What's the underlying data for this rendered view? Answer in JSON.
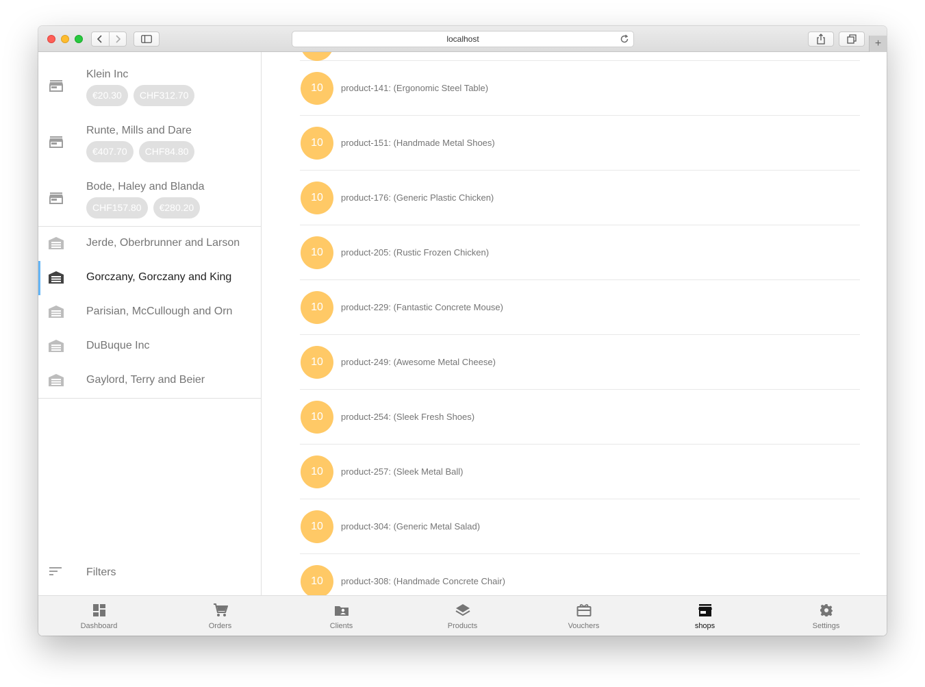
{
  "browser": {
    "url": "localhost"
  },
  "sidebar": {
    "shops": [
      {
        "name": "Klein Inc",
        "chips": [
          "€20.30",
          "CHF312.70"
        ]
      },
      {
        "name": "Runte, Mills and Dare",
        "chips": [
          "€407.70",
          "CHF84.80"
        ]
      },
      {
        "name": "Bode, Haley and Blanda",
        "chips": [
          "CHF157.80",
          "€280.20"
        ]
      }
    ],
    "warehouses": [
      {
        "name": "Jerde, Oberbrunner and Larson",
        "active": false
      },
      {
        "name": "Gorczany, Gorczany and King",
        "active": true
      },
      {
        "name": "Parisian, McCullough and Orn",
        "active": false
      },
      {
        "name": "DuBuque Inc",
        "active": false
      },
      {
        "name": "Gaylord, Terry and Beier",
        "active": false
      }
    ],
    "filters_label": "Filters"
  },
  "products": [
    {
      "qty": "10",
      "label": "product-141: (Ergonomic Steel Table)"
    },
    {
      "qty": "10",
      "label": "product-151: (Handmade Metal Shoes)"
    },
    {
      "qty": "10",
      "label": "product-176: (Generic Plastic Chicken)"
    },
    {
      "qty": "10",
      "label": "product-205: (Rustic Frozen Chicken)"
    },
    {
      "qty": "10",
      "label": "product-229: (Fantastic Concrete Mouse)"
    },
    {
      "qty": "10",
      "label": "product-249: (Awesome Metal Cheese)"
    },
    {
      "qty": "10",
      "label": "product-254: (Sleek Fresh Shoes)"
    },
    {
      "qty": "10",
      "label": "product-257: (Sleek Metal Ball)"
    },
    {
      "qty": "10",
      "label": "product-304: (Generic Metal Salad)"
    },
    {
      "qty": "10",
      "label": "product-308: (Handmade Concrete Chair)"
    }
  ],
  "bottom_nav": {
    "items": [
      {
        "label": "Dashboard",
        "icon": "dashboard-icon"
      },
      {
        "label": "Orders",
        "icon": "cart-icon"
      },
      {
        "label": "Clients",
        "icon": "contacts-folder-icon"
      },
      {
        "label": "Products",
        "icon": "layers-icon"
      },
      {
        "label": "Vouchers",
        "icon": "gift-card-icon"
      },
      {
        "label": "shops",
        "icon": "store-icon",
        "active": true
      },
      {
        "label": "Settings",
        "icon": "gear-icon"
      }
    ]
  },
  "colors": {
    "qty_badge": "#ffc966",
    "active_indicator": "#64b5f6",
    "chip_bg": "#e0e0e0"
  }
}
